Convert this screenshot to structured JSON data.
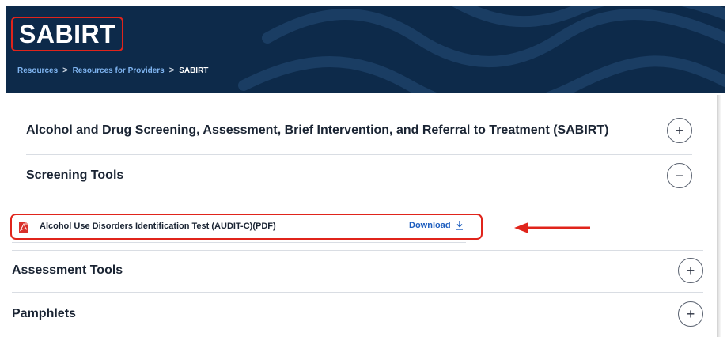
{
  "page": {
    "title": "SABIRT"
  },
  "breadcrumb": {
    "items": [
      "Resources",
      "Resources for Providers"
    ],
    "separator": ">",
    "current": "SABIRT"
  },
  "accordion": {
    "sections": [
      {
        "title": "Alcohol and Drug Screening, Assessment, Brief Intervention, and Referral to Treatment (SABIRT)",
        "toggle": "+"
      },
      {
        "title": "Screening Tools",
        "toggle": "−"
      },
      {
        "title": "Assessment Tools",
        "toggle": "+"
      },
      {
        "title": "Pamphlets",
        "toggle": "+"
      }
    ]
  },
  "screening_file": {
    "name": "Alcohol Use Disorders Identification Test (AUDIT-C)(PDF)",
    "action_label": "Download",
    "icon": "pdf-file-icon",
    "action_icon": "download-icon"
  },
  "colors": {
    "hero_background": "#0d2a4a",
    "highlight": "#e0241b",
    "link": "#1f5fbf",
    "breadcrumb_link": "#7fb4f0"
  }
}
